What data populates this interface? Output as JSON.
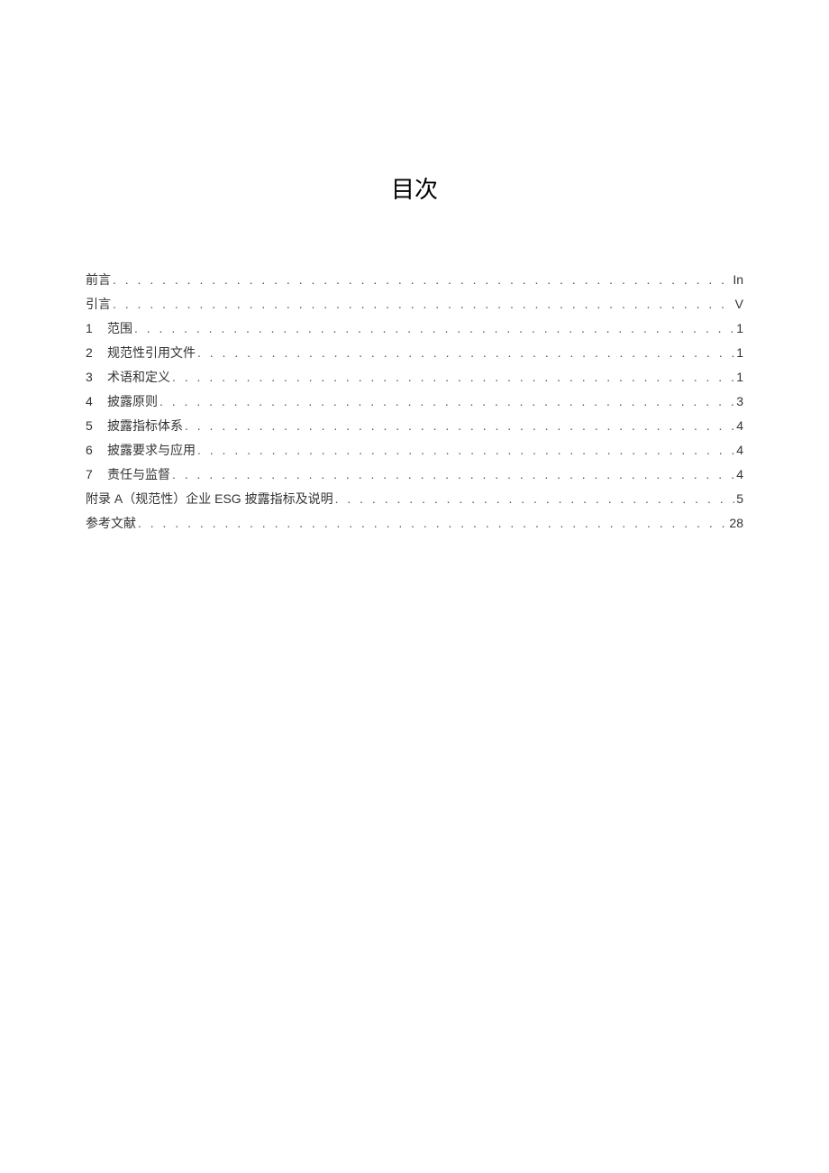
{
  "title": "目次",
  "toc": [
    {
      "num": "",
      "label": "前言",
      "page": "In"
    },
    {
      "num": "",
      "label": "引言",
      "page": "V"
    },
    {
      "num": "1",
      "label": "范围",
      "page": "1"
    },
    {
      "num": "2",
      "label": "规范性引用文件",
      "page": "1"
    },
    {
      "num": "3",
      "label": "术语和定义",
      "page": "1"
    },
    {
      "num": "4",
      "label": "披露原则",
      "page": "3"
    },
    {
      "num": "5",
      "label": "披露指标体系",
      "page": "4"
    },
    {
      "num": "6",
      "label": "披露要求与应用",
      "page": "4"
    },
    {
      "num": "7",
      "label": "责任与监督",
      "page": "4"
    },
    {
      "num": "",
      "label": "附录 A（规范性）企业 ESG 披露指标及说明",
      "page": "5"
    },
    {
      "num": "",
      "label": "参考文献",
      "page": "28"
    }
  ]
}
